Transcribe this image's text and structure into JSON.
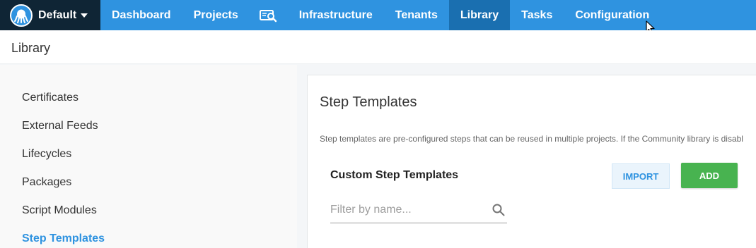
{
  "space": {
    "name": "Default"
  },
  "nav": {
    "items": [
      {
        "label": "Dashboard"
      },
      {
        "label": "Projects"
      },
      {
        "label": "Infrastructure"
      },
      {
        "label": "Tenants"
      },
      {
        "label": "Library"
      },
      {
        "label": "Tasks"
      },
      {
        "label": "Configuration"
      }
    ],
    "active": "Library",
    "icon": "search-dashboard-icon"
  },
  "page": {
    "title": "Library"
  },
  "sidebar": {
    "items": [
      {
        "label": "Certificates"
      },
      {
        "label": "External Feeds"
      },
      {
        "label": "Lifecycles"
      },
      {
        "label": "Packages"
      },
      {
        "label": "Script Modules"
      },
      {
        "label": "Step Templates"
      }
    ],
    "active": "Step Templates"
  },
  "main": {
    "title": "Step Templates",
    "description": "Step templates are pre-configured steps that can be reused in multiple projects. If the Community library is disabl",
    "section_title": "Custom Step Templates",
    "import_label": "IMPORT",
    "add_label": "ADD",
    "filter": {
      "placeholder": "Filter by name...",
      "value": ""
    }
  },
  "colors": {
    "nav_bg": "#2f93e0",
    "nav_active": "#1a6fb0",
    "space_bg": "#0f2535",
    "accent": "#2f93e0",
    "add_button": "#48b350"
  }
}
